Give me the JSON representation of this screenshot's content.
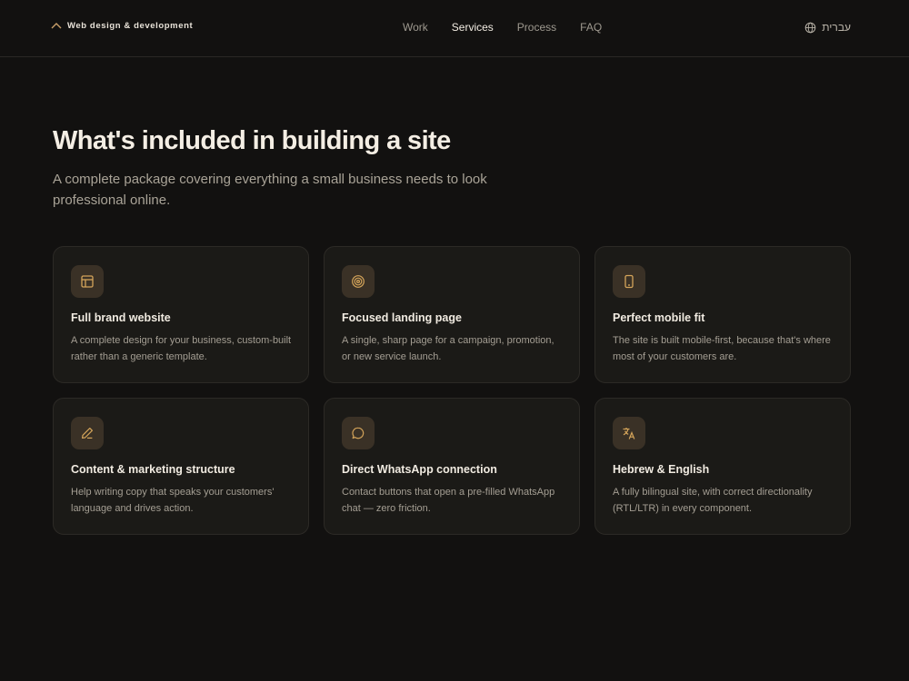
{
  "header": {
    "brand": "Web design & development",
    "nav": [
      "Work",
      "Services",
      "Process",
      "FAQ"
    ],
    "active_nav": "Services",
    "language": "עברית"
  },
  "hero": {
    "title": "What's included in building a site",
    "subtitle": "A complete package covering everything a small business needs to look professional online."
  },
  "features": [
    {
      "icon": "layout-icon",
      "title": "Full brand website",
      "description": "A complete design for your business, custom-built rather than a generic template."
    },
    {
      "icon": "target-icon",
      "title": "Focused landing page",
      "description": "A single, sharp page for a campaign, promotion, or new service launch."
    },
    {
      "icon": "smartphone-icon",
      "title": "Perfect mobile fit",
      "description": "The site is built mobile-first, because that's where most of your customers are."
    },
    {
      "icon": "pencil-icon",
      "title": "Content & marketing structure",
      "description": "Help writing copy that speaks your customers' language and drives action."
    },
    {
      "icon": "chat-bubble-icon",
      "title": "Direct WhatsApp connection",
      "description": "Contact buttons that open a pre-filled WhatsApp chat — zero friction."
    },
    {
      "icon": "translate-icon",
      "title": "Hebrew & English",
      "description": "A fully bilingual site, with correct directionality (RTL/LTR) in every component."
    }
  ],
  "colors": {
    "background": "#121110",
    "card": "#1b1a17",
    "accent": "#d4a45a"
  }
}
